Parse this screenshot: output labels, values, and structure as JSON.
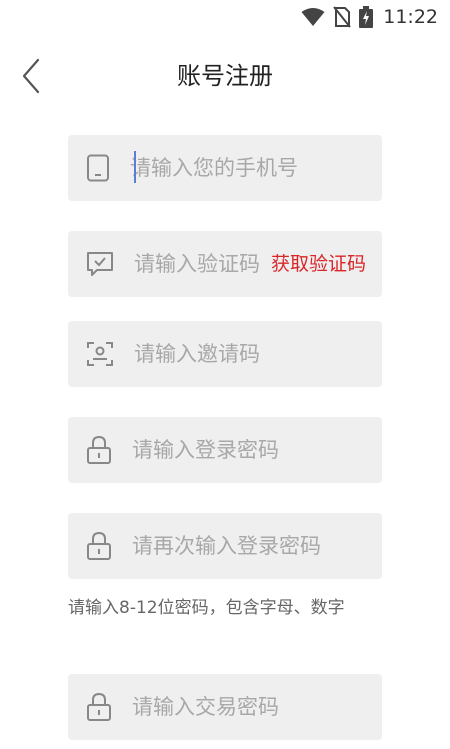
{
  "status": {
    "time": "11:22"
  },
  "header": {
    "title": "账号注册"
  },
  "form": {
    "phone_placeholder": "请输入您的手机号",
    "code_placeholder": "请输入验证码",
    "get_code_label": "获取验证码",
    "invite_placeholder": "请输入邀请码",
    "password_placeholder": "请输入登录密码",
    "password_confirm_placeholder": "请再次输入登录密码",
    "password_hint": "请输入8-12位密码，包含字母、数字",
    "trade_password_placeholder": "请输入交易密码"
  },
  "icons": {
    "phone": "phone-icon",
    "code": "message-check-icon",
    "invite": "id-card-icon",
    "lock": "lock-icon",
    "back": "chevron-left-icon"
  },
  "colors": {
    "accent": "#d9262a",
    "field_bg": "#efefef",
    "icon": "#888888"
  }
}
